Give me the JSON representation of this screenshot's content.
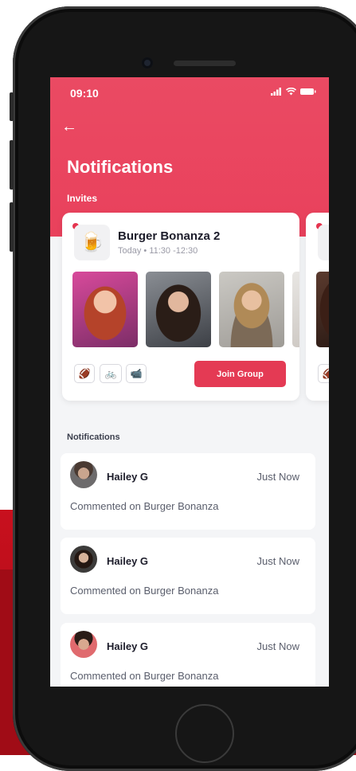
{
  "status_bar": {
    "time": "09:10"
  },
  "header": {
    "title": "Notifications",
    "invites_label": "Invites"
  },
  "invite": {
    "event_name": "Burger Bonanza 2",
    "event_time": "Today • 11:30 -12:30",
    "event_icon": "beer-mug-icon",
    "tags": [
      "football-icon",
      "bicycle-icon",
      "camera-icon"
    ],
    "join_label": "Join Group"
  },
  "notifications_label": "Notifications",
  "notifications": [
    {
      "name": "Hailey G",
      "time": "Just Now",
      "text": "Commented on Burger Bonanza"
    },
    {
      "name": "Hailey G",
      "time": "Just Now",
      "text": "Commented on Burger Bonanza"
    },
    {
      "name": "Hailey G",
      "time": "Just Now",
      "text": "Commented on Burger Bonanza"
    }
  ],
  "colors": {
    "accent": "#e9415c",
    "background": "#f4f5f7"
  }
}
